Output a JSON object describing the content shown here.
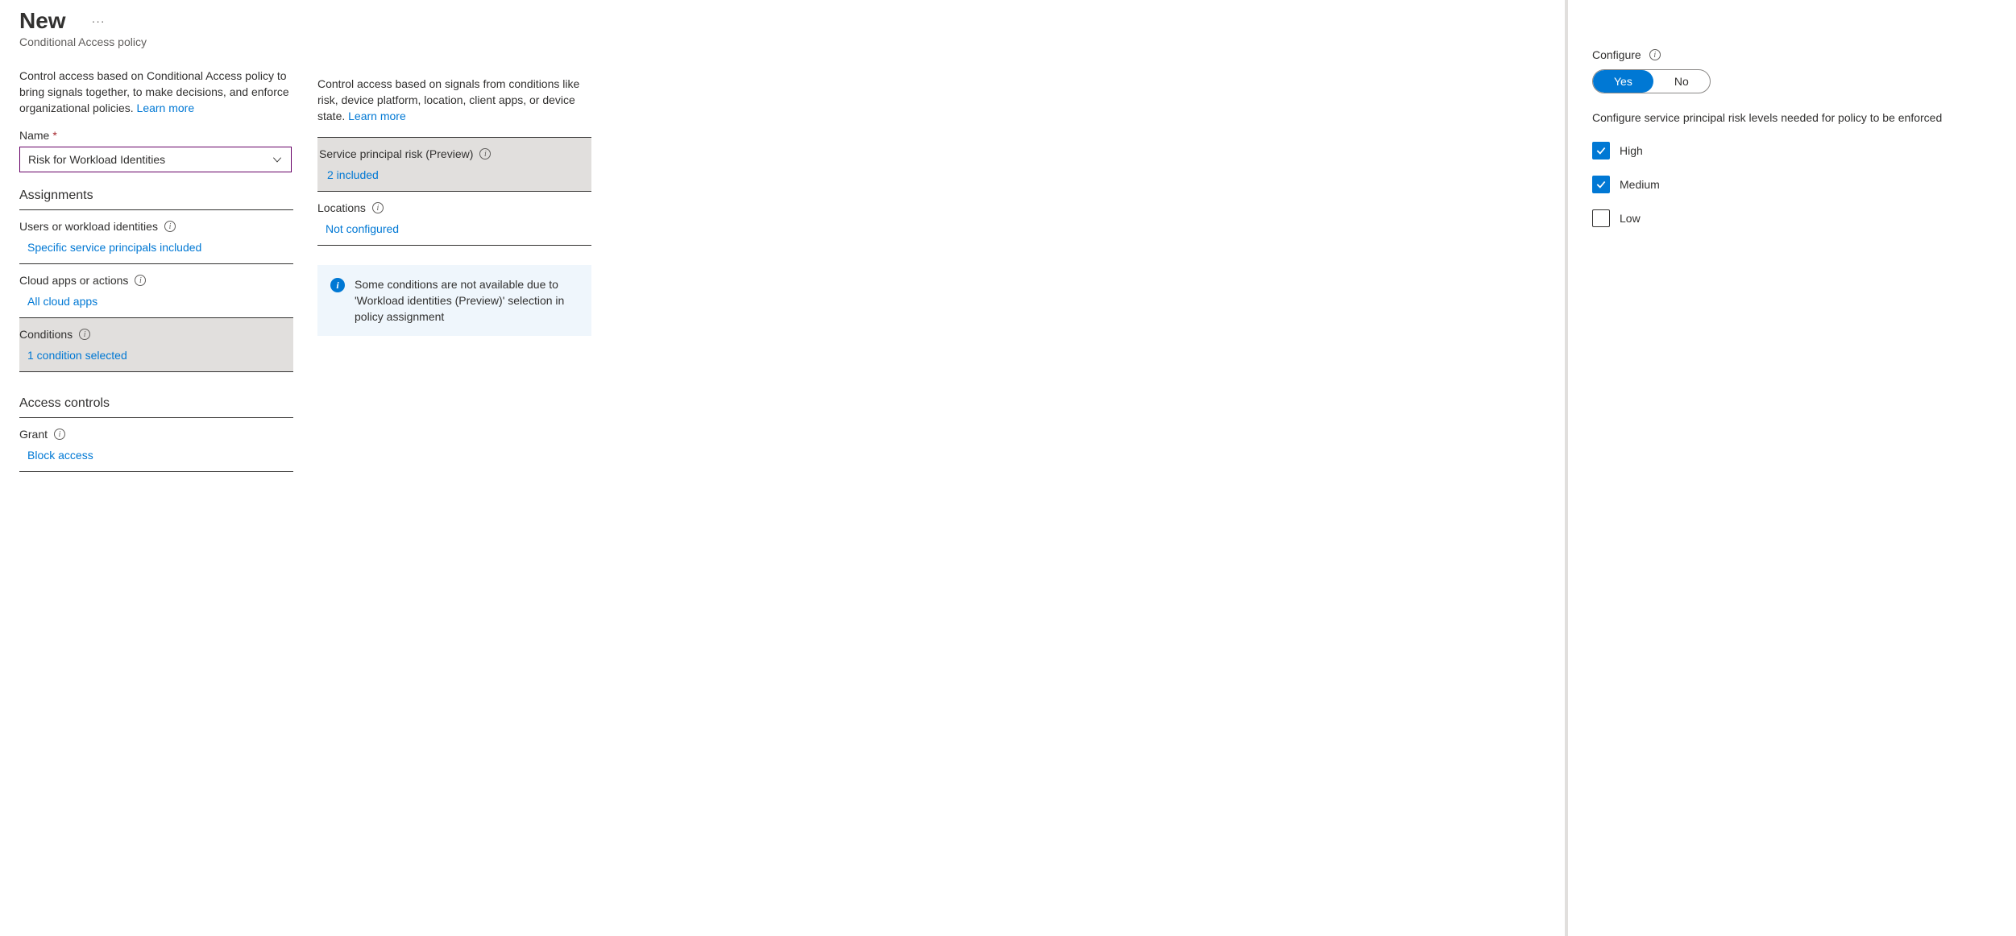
{
  "header": {
    "title": "New",
    "subtitle": "Conditional Access policy"
  },
  "left": {
    "description": "Control access based on Conditional Access policy to bring signals together, to make decisions, and enforce organizational policies.",
    "learn_more": "Learn more",
    "name_label": "Name",
    "name_value": "Risk for Workload Identities",
    "section_assignments": "Assignments",
    "users_label": "Users or workload identities",
    "users_value": "Specific service principals included",
    "cloud_label": "Cloud apps or actions",
    "cloud_value": "All cloud apps",
    "conditions_label": "Conditions",
    "conditions_value": "1 condition selected",
    "section_access": "Access controls",
    "grant_label": "Grant",
    "grant_value": "Block access"
  },
  "middle": {
    "description": "Control access based on signals from conditions like risk, device platform, location, client apps, or device state.",
    "learn_more": "Learn more",
    "sprisk_label": "Service principal risk (Preview)",
    "sprisk_value": "2 included",
    "locations_label": "Locations",
    "locations_value": "Not configured",
    "info_text": "Some conditions are not available due to 'Workload identities (Preview)' selection in policy assignment"
  },
  "right": {
    "configure_label": "Configure",
    "toggle_yes": "Yes",
    "toggle_no": "No",
    "desc": "Configure service principal risk levels needed for policy to be enforced",
    "opt_high": "High",
    "opt_medium": "Medium",
    "opt_low": "Low",
    "high_checked": true,
    "medium_checked": true,
    "low_checked": false
  }
}
